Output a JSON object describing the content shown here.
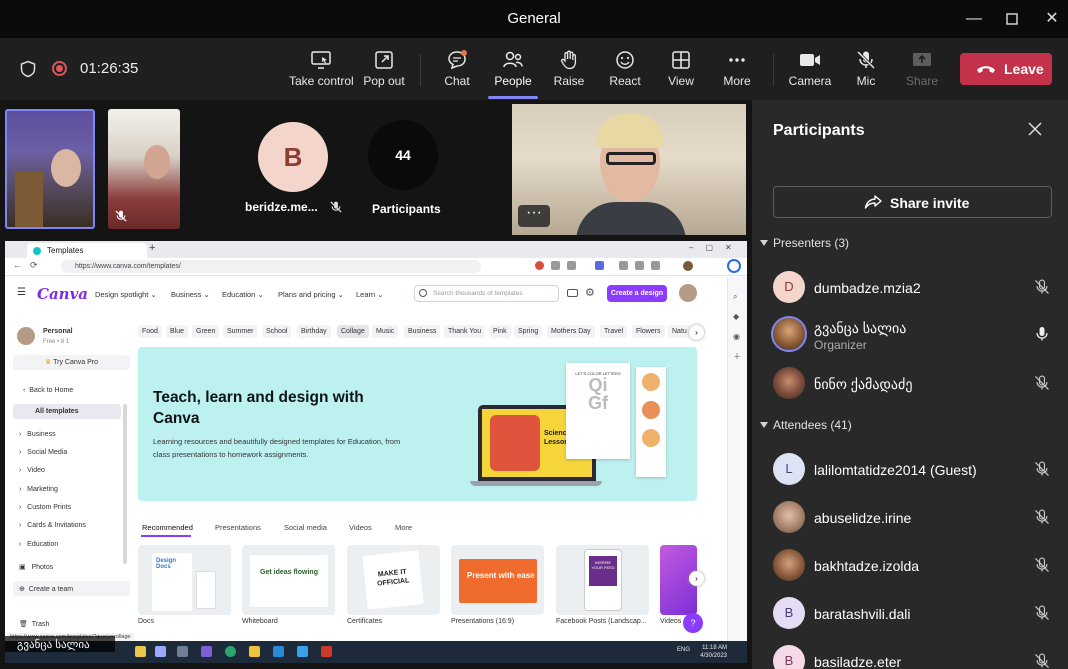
{
  "window": {
    "title": "General"
  },
  "meeting": {
    "timer": "01:26:35"
  },
  "toolbar": {
    "take_control": "Take control",
    "pop_out": "Pop out",
    "chat": "Chat",
    "people": "People",
    "raise": "Raise",
    "react": "React",
    "view": "View",
    "more": "More",
    "camera": "Camera",
    "mic": "Mic",
    "share": "Share",
    "leave": "Leave"
  },
  "stage": {
    "avatar_letter": "B",
    "avatar_name": "beridze.me...",
    "participants_count": "44",
    "participants_label": "Participants",
    "more_dots": "···"
  },
  "browser": {
    "tab_title": "Templates",
    "url": "https://www.canva.com/templates/",
    "status_url": "https://www.canva.com/templates/?query=collage"
  },
  "canva": {
    "logo": "Canva",
    "nav": [
      "Design spotlight ⌄",
      "Business ⌄",
      "Education ⌄",
      "Plans and pricing ⌄",
      "Learn ⌄"
    ],
    "search_placeholder": "Search thousands of templates",
    "create_button": "Create a design",
    "account_name": "Personal",
    "account_sub": "Free • 8 1",
    "try_pro": "Try Canva Pro",
    "back_home": "Back to Home",
    "sidebar": [
      "All templates",
      "Business",
      "Social Media",
      "Video",
      "Marketing",
      "Custom Prints",
      "Cards & Invitations",
      "Education",
      "Photos",
      "Create a team",
      "Trash"
    ],
    "chips": [
      "Food",
      "Blue",
      "Green",
      "Summer",
      "School",
      "Birthday",
      "Collage",
      "Music",
      "Business",
      "Thank You",
      "Pink",
      "Spring",
      "Mothers Day",
      "Travel",
      "Flowers",
      "Natu"
    ],
    "hero_title": "Teach, learn and design with Canva",
    "hero_desc": "Learning resources and beautifully designed templates for Education, from class presentations to homework assignments.",
    "hero_art": {
      "lesson": "Science Lesson",
      "letters": "LET'S COLOR LETTERS"
    },
    "content_tabs": [
      "Recommended",
      "Presentations",
      "Social media",
      "Videos",
      "More"
    ],
    "thumbs": [
      "Docs",
      "Whiteboard",
      "Certificates",
      "Presentations (16:9)",
      "Facebook Posts (Landscap...",
      "Videos"
    ],
    "thumb_art": [
      "Design Docs",
      "Get ideas flowing",
      "MAKE IT OFFICIAL",
      "Present with ease",
      "INSPIRE YOUR FEED"
    ]
  },
  "taskbar": {
    "presenter_label": "გვანცა სალია",
    "time": "11:18 AM",
    "date": "4/30/2023",
    "lang": "ENG"
  },
  "panel": {
    "title": "Participants",
    "share_invite": "Share invite",
    "presenters_label": "Presenters (3)",
    "attendees_label": "Attendees (41)",
    "presenters": [
      {
        "initial": "D",
        "name": "dumbadze.mzia2",
        "role": ""
      },
      {
        "initial": "",
        "name": "გვანცა სალია",
        "role": "Organizer"
      },
      {
        "initial": "",
        "name": "ნინო ქამადაძე",
        "role": ""
      }
    ],
    "attendees": [
      {
        "initial": "L",
        "name": "lalilomtatidze2014 (Guest)"
      },
      {
        "initial": "",
        "name": "abuselidze.irine"
      },
      {
        "initial": "",
        "name": "bakhtadze.izolda"
      },
      {
        "initial": "B",
        "name": "baratashvili.dali"
      },
      {
        "initial": "B",
        "name": "basiladze.eter"
      }
    ]
  },
  "colors": {
    "accent": "#7f85f5",
    "leave": "#c4314b",
    "canva_purple": "#8b3dff",
    "hero_bg": "#bdf1ef"
  }
}
